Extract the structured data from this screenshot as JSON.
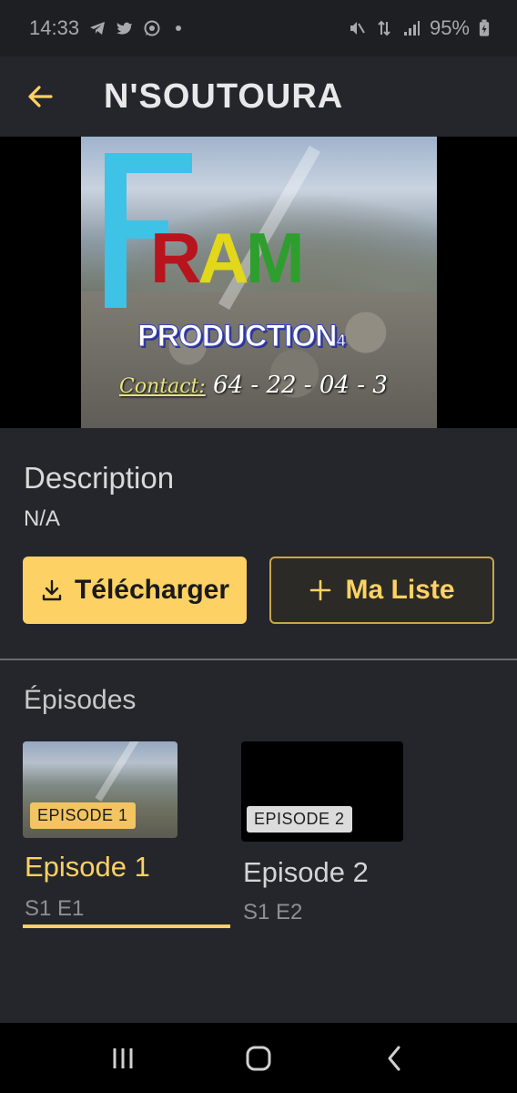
{
  "status_bar": {
    "time": "14:33",
    "battery": "95%",
    "icons": [
      "telegram-icon",
      "twitter-icon",
      "whatsapp-icon",
      "mute-icon",
      "data-icon",
      "signal-icon",
      "battery-charging-icon"
    ]
  },
  "header": {
    "title": "N'SOUTOURA",
    "back_icon": "arrow-left-icon"
  },
  "poster": {
    "logo_letters": [
      "F",
      "R",
      "A",
      "M"
    ],
    "production_text": "PRODUCTION",
    "production_suffix": "4",
    "contact_label": "Contact:",
    "contact_number": "64 - 22 - 04 - 3"
  },
  "description": {
    "label": "Description",
    "value": "N/A"
  },
  "actions": {
    "download_label": "Télécharger",
    "list_label": "Ma Liste"
  },
  "episodes": {
    "label": "Épisodes",
    "items": [
      {
        "badge": "EPISODE 1",
        "title": "Episode 1",
        "subtitle": "S1 E1",
        "selected": true
      },
      {
        "badge": "EPISODE 2",
        "title": "Episode 2",
        "subtitle": "S1 E2",
        "selected": false
      }
    ]
  },
  "colors": {
    "accent": "#fdd164",
    "background": "#25262b",
    "status_bar": "#1e1f23",
    "nav_bar": "#000000"
  },
  "nav_bar": {
    "buttons": [
      "recents-icon",
      "home-icon",
      "back-icon"
    ]
  }
}
